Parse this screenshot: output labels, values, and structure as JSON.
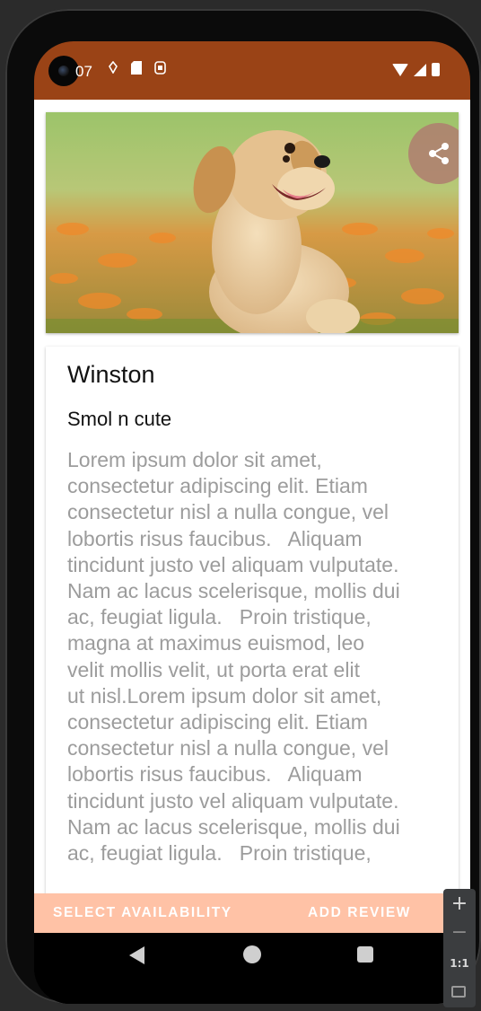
{
  "statusbar": {
    "time": "07",
    "left_icons": [
      "notification-icon",
      "sd-card-icon",
      "sim-icon"
    ],
    "right_icons": [
      "wifi-icon",
      "signal-icon",
      "battery-icon"
    ],
    "color": "#9a4316"
  },
  "hero": {
    "image": "golden-retriever-puppy-photo",
    "share_icon": "share-icon"
  },
  "pet": {
    "name": "Winston",
    "tagline": "Smol n cute",
    "description": "Lorem ipsum dolor sit amet,\nconsectetur adipiscing elit. Etiam\nconsectetur nisl a nulla congue, vel\nlobortis risus faucibus.   Aliquam\ntincidunt justo vel aliquam vulputate.\nNam ac lacus scelerisque, mollis dui\nac, feugiat ligula.   Proin tristique,\nmagna at maximus euismod, leo\nvelit mollis velit, ut porta erat elit\nut nisl.Lorem ipsum dolor sit amet,\nconsectetur adipiscing elit. Etiam\nconsectetur nisl a nulla congue, vel\nlobortis risus faucibus.   Aliquam\ntincidunt justo vel aliquam vulputate.\nNam ac lacus scelerisque, mollis dui\nac, feugiat ligula.   Proin tristique,"
  },
  "actions": {
    "select_availability": "SELECT AVAILABILITY",
    "add_review": "ADD REVIEW",
    "bar_color": "#ffc2a6"
  },
  "navbar": {
    "back": "back-icon",
    "home": "home-icon",
    "recents": "recents-icon"
  },
  "zoom_controls": {
    "zoom_in": "+",
    "zoom_out": "−",
    "reset": "1:1"
  }
}
